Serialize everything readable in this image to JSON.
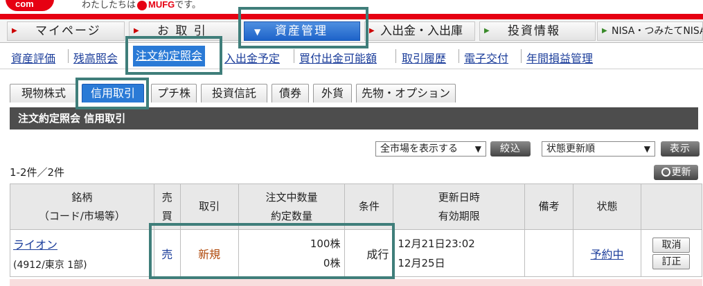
{
  "brand": {
    "logo_text": "com",
    "tagline_prefix": "わたしたちは",
    "tagline_brand": "MUFG",
    "tagline_suffix": "です。"
  },
  "main_nav": [
    {
      "label": "マイページ",
      "active": false
    },
    {
      "label": "お 取 引",
      "active": false
    },
    {
      "label": "資産管理",
      "active": true
    },
    {
      "label": "入出金・入出庫",
      "active": false
    },
    {
      "label": "投資情報",
      "active": false
    },
    {
      "label": "NISA・つみたてNISA",
      "active": false
    }
  ],
  "sub_nav": [
    {
      "label": "資産評価",
      "active": false
    },
    {
      "label": "残高照会",
      "active": false
    },
    {
      "label": "注文約定照会",
      "active": true
    },
    {
      "label": "入出金予定",
      "active": false
    },
    {
      "label": "買付出金可能額",
      "active": false
    },
    {
      "label": "取引履歴",
      "active": false
    },
    {
      "label": "電子交付",
      "active": false
    },
    {
      "label": "年間損益管理",
      "active": false
    }
  ],
  "product_tabs": [
    {
      "label": "現物株式",
      "active": false
    },
    {
      "label": "信用取引",
      "active": true
    },
    {
      "label": "プチ株",
      "active": false
    },
    {
      "label": "投資信託",
      "active": false
    },
    {
      "label": "債券",
      "active": false
    },
    {
      "label": "外貨",
      "active": false
    },
    {
      "label": "先物・オプション",
      "active": false
    }
  ],
  "section_title": "注文約定照会 信用取引",
  "filters": {
    "market_select": "全市場を表示する",
    "filter_button": "絞込",
    "sort_select": "状態更新順",
    "show_button": "表示"
  },
  "result_count": "1-2件／2件",
  "refresh_button": "更新",
  "table": {
    "headers": {
      "stock_line1": "銘柄",
      "stock_line2": "（コード/市場等）",
      "side_line1": "売",
      "side_line2": "買",
      "trade": "取引",
      "qty_line1": "注文中数量",
      "qty_line2": "約定数量",
      "condition": "条件",
      "date_line1": "更新日時",
      "date_line2": "有効期限",
      "remarks": "備考",
      "status": "状態"
    },
    "rows": [
      {
        "stock_name": "ライオン",
        "stock_code": "(4912/東京 1部)",
        "side": "売",
        "trade": "新規",
        "order_qty": "100株",
        "filled_qty": "0株",
        "condition": "成行",
        "updated_at": "12月21日23:02",
        "expires": "12月25日",
        "remarks": "",
        "status": "予約中",
        "cancel_label": "取消",
        "amend_label": "訂正"
      }
    ]
  }
}
